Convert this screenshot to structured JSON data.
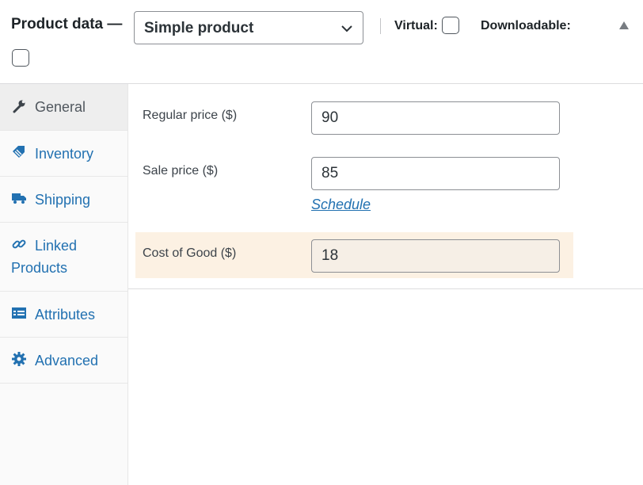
{
  "header": {
    "title": "Product data —",
    "product_type": "Simple product",
    "virtual_label": "Virtual:",
    "downloadable_label": "Downloadable:"
  },
  "tabs": [
    {
      "label": "General",
      "icon": "wrench-icon",
      "active": true
    },
    {
      "label": "Inventory",
      "icon": "tag-icon"
    },
    {
      "label": "Shipping",
      "icon": "truck-icon"
    },
    {
      "label_line1": "Linked",
      "label_line2": "Products",
      "icon": "link-icon"
    },
    {
      "label": "Attributes",
      "icon": "list-icon"
    },
    {
      "label": "Advanced",
      "icon": "gear-icon"
    }
  ],
  "general": {
    "regular_price_label": "Regular price ($)",
    "regular_price_value": "90",
    "sale_price_label": "Sale price ($)",
    "sale_price_value": "85",
    "schedule_link": "Schedule",
    "cost_label": "Cost of Good ($)",
    "cost_value": "18"
  },
  "colors": {
    "link": "#2271b1",
    "highlight": "#fcf1e3",
    "text": "#1d2327"
  }
}
